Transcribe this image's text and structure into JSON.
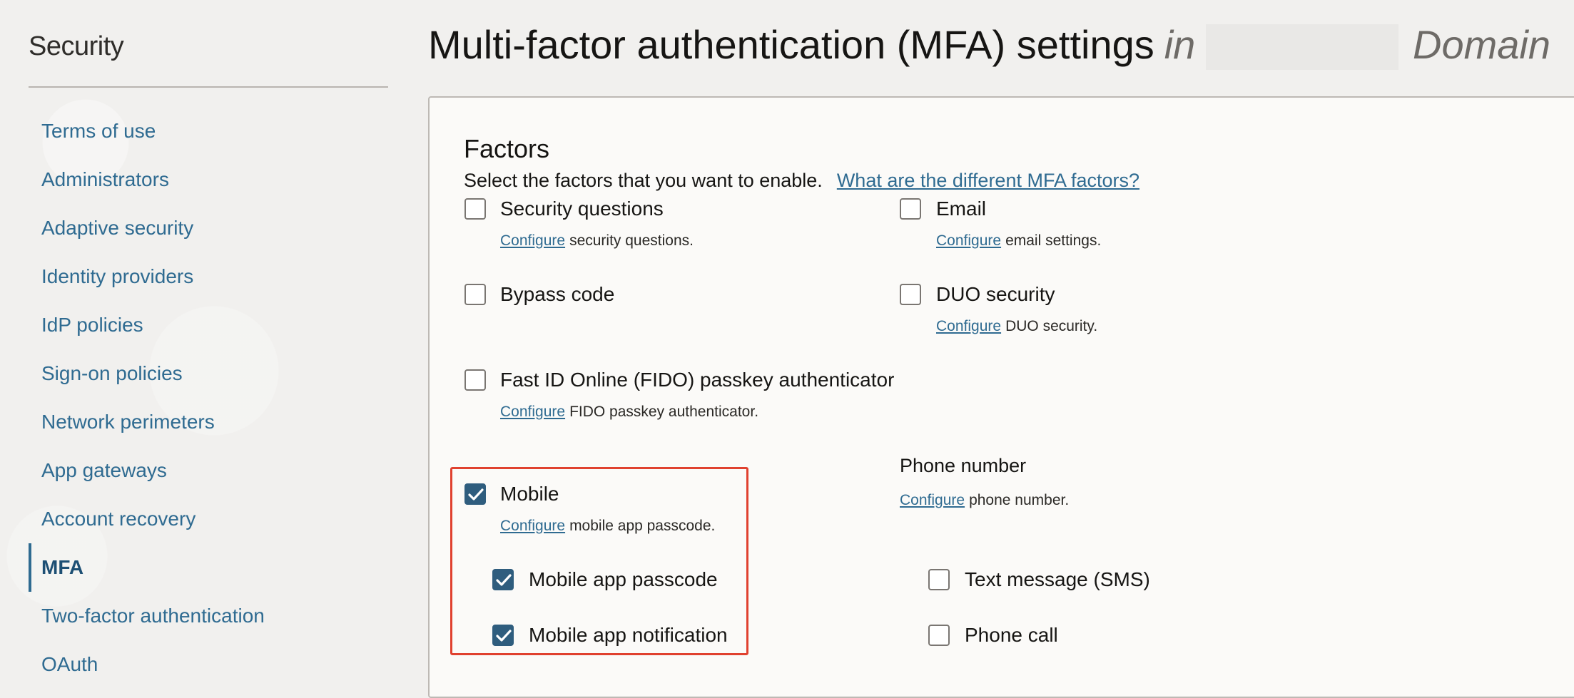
{
  "sidebar": {
    "title": "Security",
    "items": [
      {
        "label": "Terms of use",
        "active": false
      },
      {
        "label": "Administrators",
        "active": false
      },
      {
        "label": "Adaptive security",
        "active": false
      },
      {
        "label": "Identity providers",
        "active": false
      },
      {
        "label": "IdP policies",
        "active": false
      },
      {
        "label": "Sign-on policies",
        "active": false
      },
      {
        "label": "Network perimeters",
        "active": false
      },
      {
        "label": "App gateways",
        "active": false
      },
      {
        "label": "Account recovery",
        "active": false
      },
      {
        "label": "MFA",
        "active": true
      },
      {
        "label": "Two-factor authentication",
        "active": false
      },
      {
        "label": "OAuth",
        "active": false
      }
    ]
  },
  "header": {
    "title": "Multi-factor authentication (MFA) settings",
    "in_word": "in",
    "domain_label": "Domain"
  },
  "factors": {
    "heading": "Factors",
    "description": "Select the factors that you want to enable.",
    "help_link": "What are the different MFA factors?",
    "configure_link": "Configure",
    "options": {
      "security_questions": {
        "label": "Security questions",
        "checked": false,
        "config_text": "security questions."
      },
      "email": {
        "label": "Email",
        "checked": false,
        "config_text": "email settings."
      },
      "bypass_code": {
        "label": "Bypass code",
        "checked": false
      },
      "duo_security": {
        "label": "DUO security",
        "checked": false,
        "config_text": "DUO security."
      },
      "fido": {
        "label": "Fast ID Online (FIDO) passkey authenticator",
        "checked": false,
        "config_text": "FIDO passkey authenticator."
      },
      "mobile": {
        "label": "Mobile",
        "checked": true,
        "config_text": "mobile app passcode."
      },
      "mobile_app_passcode": {
        "label": "Mobile app passcode",
        "checked": true
      },
      "mobile_app_notification": {
        "label": "Mobile app notification",
        "checked": true
      },
      "text_message": {
        "label": "Text message (SMS)",
        "checked": false
      },
      "phone_call": {
        "label": "Phone call",
        "checked": false
      }
    },
    "phone_number": {
      "heading": "Phone number",
      "config_text": "phone number."
    }
  },
  "colors": {
    "accent": "#2f6b91",
    "checkbox_checked": "#2f5d7e",
    "highlight": "#e0412f"
  }
}
